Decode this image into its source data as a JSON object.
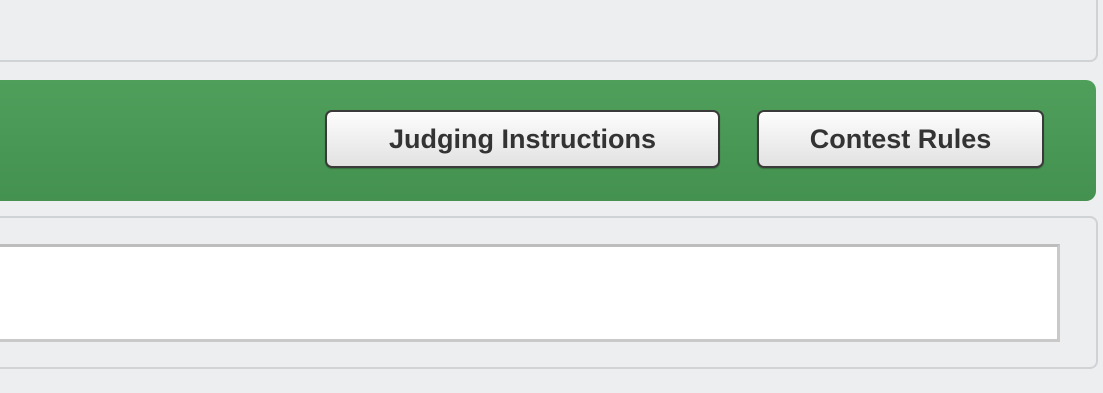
{
  "toolbar": {
    "judging_instructions_label": "Judging Instructions",
    "contest_rules_label": "Contest Rules",
    "background_color": "#449150"
  },
  "entry_field": {
    "value": "",
    "placeholder": ""
  },
  "colors": {
    "page_background": "#eceef0",
    "button_border": "#3a3a3a",
    "button_text": "#333333"
  }
}
